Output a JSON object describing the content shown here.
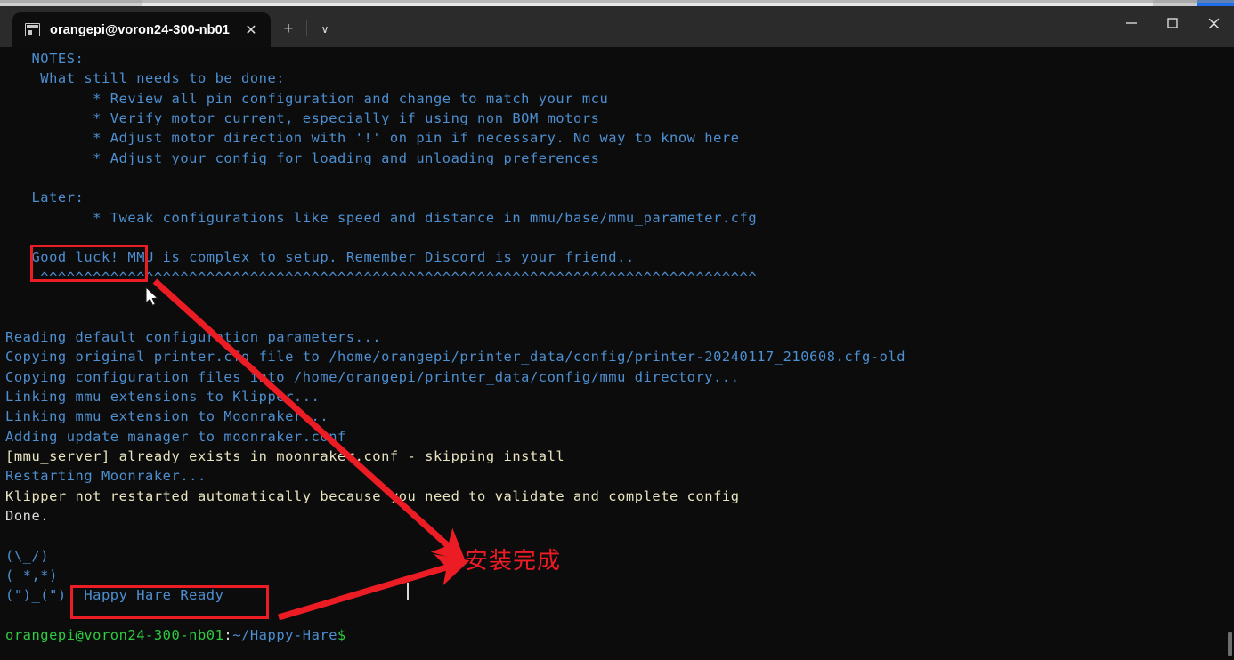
{
  "window": {
    "tab": {
      "title": "orangepi@voron24-300-nb01",
      "icon": "terminal-icon",
      "close_label": "✕"
    },
    "new_tab_label": "+",
    "tab_menu_label": "∨",
    "controls": {
      "minimize": "minimize-icon",
      "maximize": "maximize-icon",
      "close": "close-icon"
    }
  },
  "terminal": {
    "lines": [
      {
        "id": "l01",
        "segments": [
          {
            "text": "   NOTES:",
            "color": "blue"
          }
        ]
      },
      {
        "id": "l02",
        "segments": [
          {
            "text": "    What still needs to be done:",
            "color": "blue"
          }
        ]
      },
      {
        "id": "l03",
        "segments": [
          {
            "text": "          * Review all pin configuration and change to match your mcu",
            "color": "blue"
          }
        ]
      },
      {
        "id": "l04",
        "segments": [
          {
            "text": "          * Verify motor current, especially if using non BOM motors",
            "color": "blue"
          }
        ]
      },
      {
        "id": "l05",
        "segments": [
          {
            "text": "          * Adjust motor direction with '!' on pin if necessary. No way to know here",
            "color": "blue"
          }
        ]
      },
      {
        "id": "l06",
        "segments": [
          {
            "text": "          * Adjust your config for loading and unloading preferences",
            "color": "blue"
          }
        ]
      },
      {
        "id": "l07",
        "segments": [
          {
            "text": "",
            "color": "blue"
          }
        ]
      },
      {
        "id": "l08",
        "segments": [
          {
            "text": "   Later:",
            "color": "blue"
          }
        ]
      },
      {
        "id": "l09",
        "segments": [
          {
            "text": "          * Tweak configurations like speed and distance in mmu/base/mmu_parameter.cfg",
            "color": "blue"
          }
        ]
      },
      {
        "id": "l10",
        "segments": [
          {
            "text": "",
            "color": "blue"
          }
        ]
      },
      {
        "id": "l11",
        "segments": [
          {
            "text": "   Good luck! MMU is complex to setup. Remember Discord is your friend..",
            "color": "blue"
          }
        ]
      },
      {
        "id": "l12",
        "segments": [
          {
            "text": "    ^^^^^^^^^^^^^^^^^^^^^^^^^^^^^^^^^^^^^^^^^^^^^^^^^^^^^^^^^^^^^^^^^^^^^^^^^^^^^^^^^^",
            "color": "blue"
          }
        ]
      },
      {
        "id": "l13",
        "segments": [
          {
            "text": "",
            "color": "blue"
          }
        ]
      },
      {
        "id": "l14",
        "segments": [
          {
            "text": "",
            "color": "blue"
          }
        ]
      },
      {
        "id": "l15",
        "segments": [
          {
            "text": "Reading default configuration parameters...",
            "color": "blue"
          }
        ]
      },
      {
        "id": "l16",
        "segments": [
          {
            "text": "Copying original printer.cfg file to /home/orangepi/printer_data/config/printer-20240117_210608.cfg-old",
            "color": "blue"
          }
        ]
      },
      {
        "id": "l17",
        "segments": [
          {
            "text": "Copying configuration files into /home/orangepi/printer_data/config/mmu directory...",
            "color": "blue"
          }
        ]
      },
      {
        "id": "l18",
        "segments": [
          {
            "text": "Linking mmu extensions to Klipper...",
            "color": "blue"
          }
        ]
      },
      {
        "id": "l19",
        "segments": [
          {
            "text": "Linking mmu extension to Moonraker...",
            "color": "blue"
          }
        ]
      },
      {
        "id": "l20",
        "segments": [
          {
            "text": "Adding update manager to moonraker.conf",
            "color": "blue"
          }
        ]
      },
      {
        "id": "l21",
        "segments": [
          {
            "text": "[mmu_server] already exists in moonraker.conf - skipping install",
            "color": "cream"
          }
        ]
      },
      {
        "id": "l22",
        "segments": [
          {
            "text": "Restarting Moonraker...",
            "color": "blue"
          }
        ]
      },
      {
        "id": "l23",
        "segments": [
          {
            "text": "Klipper not restarted automatically because you need to validate and complete config",
            "color": "cream"
          }
        ]
      },
      {
        "id": "l24",
        "segments": [
          {
            "text": "Done.",
            "color": "white"
          }
        ]
      },
      {
        "id": "l25",
        "segments": [
          {
            "text": "",
            "color": "blue"
          }
        ]
      },
      {
        "id": "l26",
        "segments": [
          {
            "text": "(\\_/)",
            "color": "blue"
          }
        ]
      },
      {
        "id": "l27",
        "segments": [
          {
            "text": "( *,*)",
            "color": "blue"
          }
        ]
      },
      {
        "id": "l28",
        "segments": [
          {
            "text": "(\")_(\")  Happy Hare Ready",
            "color": "blue"
          }
        ]
      },
      {
        "id": "l29",
        "segments": [
          {
            "text": "",
            "color": "blue"
          }
        ]
      },
      {
        "id": "l30",
        "segments": [
          {
            "text": "orangepi@voron24-300-nb01",
            "color": "green"
          },
          {
            "text": ":",
            "color": "white"
          },
          {
            "text": "~/Happy-Hare",
            "color": "blue"
          },
          {
            "text": "$ ",
            "color": "green"
          }
        ]
      }
    ]
  },
  "annotations": {
    "color": "#ec1c24",
    "highlight_boxes": [
      {
        "name": "good-luck",
        "target": "Good luck!"
      },
      {
        "name": "happy-hare-ready",
        "target": "Happy Hare Ready"
      }
    ],
    "callout_text": "安装完成",
    "arrows": [
      {
        "name": "arrow-from-good-luck",
        "from": "Good luck! box",
        "to": "callout"
      },
      {
        "name": "arrow-from-happy-hare-ready",
        "from": "Happy Hare Ready box",
        "to": "callout"
      }
    ]
  }
}
